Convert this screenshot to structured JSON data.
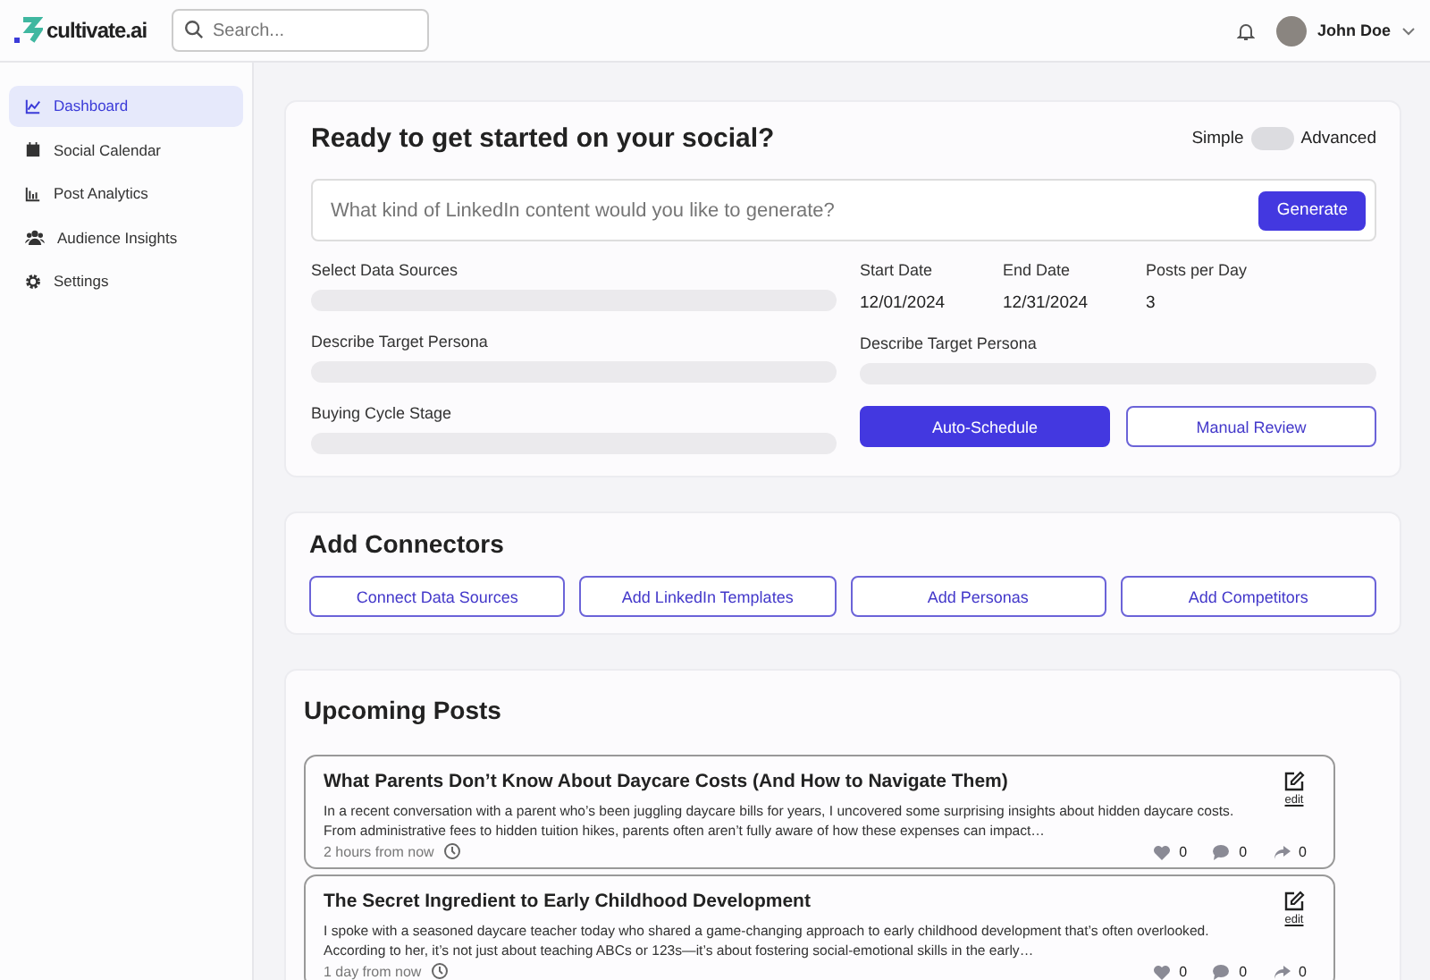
{
  "header": {
    "logo": "cultivate.ai",
    "search": {
      "placeholder": "Search..."
    },
    "user": {
      "name": "John Doe"
    }
  },
  "sidebar": {
    "items": [
      {
        "label": "Dashboard",
        "kind": "chart",
        "selected": true
      },
      {
        "label": "Social Calendar",
        "kind": "calendar",
        "selected": false
      },
      {
        "label": "Post Analytics",
        "kind": "bars",
        "selected": false
      },
      {
        "label": "Audience Insights",
        "kind": "people",
        "selected": false
      },
      {
        "label": "Settings",
        "kind": "gear",
        "selected": false
      }
    ]
  },
  "generator": {
    "title": "Ready to get started on your social?",
    "mode": {
      "left": "Simple",
      "right": "Advanced",
      "on": false
    },
    "prompt": {
      "placeholder": "What kind of LinkedIn content would you like to generate?",
      "button": "Generate"
    },
    "left_fields": [
      {
        "label": "Select Data Sources"
      },
      {
        "label": "Describe Target Persona"
      },
      {
        "label": "Buying Cycle Stage"
      }
    ],
    "dates": [
      {
        "label": "Start Date",
        "value": "12/01/2024"
      },
      {
        "label": "End Date",
        "value": "12/31/2024"
      },
      {
        "label": "Posts per Day",
        "value": "3"
      }
    ],
    "right_field": {
      "label": "Describe Target Persona"
    },
    "actions": [
      {
        "label": "Auto-Schedule",
        "kind": "primary"
      },
      {
        "label": "Manual Review",
        "kind": "outline"
      }
    ]
  },
  "connectors": {
    "title": "Add Connectors",
    "buttons": [
      "Connect Data Sources",
      "Add LinkedIn Templates",
      "Add Personas",
      "Add Competitors"
    ]
  },
  "upcoming": {
    "title": "Upcoming Posts",
    "posts": [
      {
        "title": "What Parents Don’t Know About Daycare Costs (And How to Navigate Them)",
        "body": "In a recent conversation with a parent who’s been juggling daycare bills for years, I uncovered some surprising insights about hidden daycare costs. From administrative fees to hidden tuition hikes, parents often aren’t fully aware of how these expenses can impact…",
        "time": "2 hours from now",
        "edit": "edit",
        "likes": "0",
        "comments": "0",
        "shares": "0"
      },
      {
        "title": "The Secret Ingredient to Early Childhood Development",
        "body": "I spoke with a seasoned daycare teacher today who shared a game-changing approach to early childhood development that’s often overlooked. According to her, it’s not just about teaching ABCs or 123s—it’s about fostering social-emotional skills in the early…",
        "time": "1 day from now",
        "edit": "edit",
        "likes": "0",
        "comments": "0",
        "shares": "0"
      }
    ]
  }
}
